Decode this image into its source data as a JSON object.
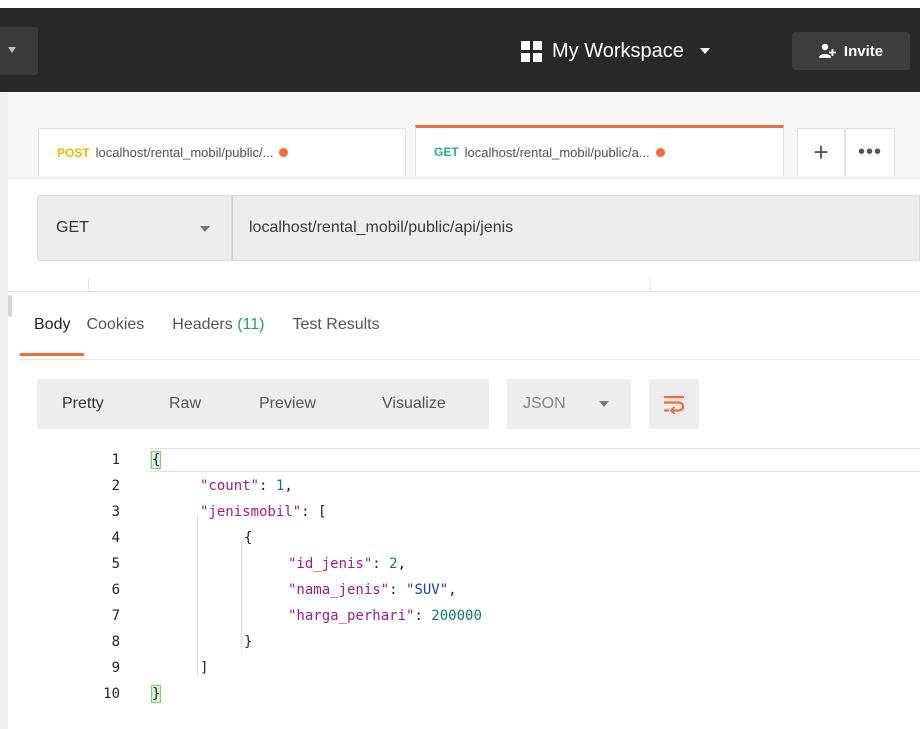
{
  "header": {
    "workspace_label": "My Workspace",
    "invite_label": "Invite"
  },
  "tabs": [
    {
      "method": "POST",
      "url": "localhost/rental_mobil/public/...",
      "method_color": "#f2b600"
    },
    {
      "method": "GET",
      "url": "localhost/rental_mobil/public/a...",
      "method_color": "#26b47f"
    }
  ],
  "request": {
    "method": "GET",
    "url": "localhost/rental_mobil/public/api/jenis"
  },
  "response_tabs": {
    "body": "Body",
    "cookies": "Cookies",
    "headers": "Headers",
    "headers_count": "(11)",
    "tests": "Test Results"
  },
  "view": {
    "pretty": "Pretty",
    "raw": "Raw",
    "preview": "Preview",
    "visualize": "Visualize",
    "format": "JSON"
  },
  "code_lines": [
    {
      "n": "1",
      "text": "{"
    },
    {
      "n": "2",
      "key": "\"count\"",
      "sep": ": ",
      "val": "1",
      "vtype": "num",
      "tail": ","
    },
    {
      "n": "3",
      "key": "\"jenismobil\"",
      "sep": ": ",
      "tail": "["
    },
    {
      "n": "4",
      "text": "{"
    },
    {
      "n": "5",
      "key": "\"id_jenis\"",
      "sep": ": ",
      "val": "2",
      "vtype": "num",
      "tail": ","
    },
    {
      "n": "6",
      "key": "\"nama_jenis\"",
      "sep": ": ",
      "val": "\"SUV\"",
      "vtype": "str",
      "tail": ","
    },
    {
      "n": "7",
      "key": "\"harga_perhari\"",
      "sep": ": ",
      "val": "200000",
      "vtype": "num",
      "tail": ""
    },
    {
      "n": "8",
      "text": "}"
    },
    {
      "n": "9",
      "text": "]"
    },
    {
      "n": "10",
      "text": "}"
    }
  ],
  "colors": {
    "accent": "#f26b3a",
    "json_key": "#a11d7e",
    "json_string": "#1c3fa8",
    "json_number": "#0b7a6c"
  }
}
